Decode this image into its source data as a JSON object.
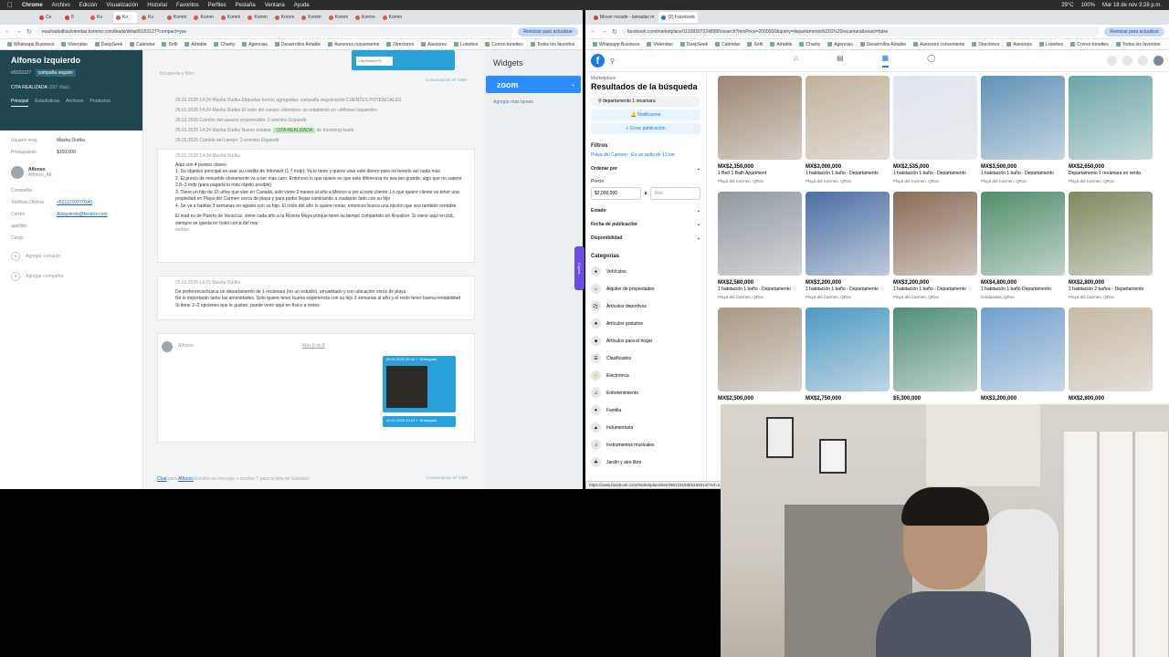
{
  "menubar": {
    "app": "Chrome",
    "items": [
      "Archivo",
      "Edición",
      "Visualización",
      "Historial",
      "Favoritos",
      "Perfiles",
      "Pestaña",
      "Ventana",
      "Ayuda"
    ],
    "clock": "Mar 18 de nov 3:28 p.m.",
    "temp": "29°C",
    "battery": "100%"
  },
  "left_browser": {
    "tabs": [
      "Ce",
      "8",
      "Ko",
      "Ko",
      "Ko",
      "Komm",
      "Komm",
      "Komm",
      "Komm",
      "Komm",
      "Komm",
      "Komm",
      "Komm",
      "Komm"
    ],
    "url": "mashadudkaviviendas.kommo.com/leads/detail/9153127?compact=yes",
    "relaunch": "Reiniciar para actualizar",
    "bookmarks": [
      "Whatsapp Business",
      "Viviendas",
      "DeepSeek",
      "Calendar",
      "Sofit",
      "Airtable",
      "Charity",
      "Agencias",
      "Desarrollos Airtable",
      "Asesores conveniente",
      "Directores",
      "Asesores",
      "Lunettes",
      "Correo tunettes",
      "Todos los favoritos"
    ]
  },
  "kommo": {
    "lead_name": "Alfonso Izquierdo",
    "lead_id": "#9153127",
    "pipeline": "campaña seguim",
    "status": "CITA REALIZADA",
    "status_days": "(297 días)",
    "tabs": [
      "Principal",
      "Estadísticas",
      "Archivos",
      "Productos"
    ],
    "fields": [
      {
        "label": "Usuario resp.",
        "value": "Masha Dudka"
      },
      {
        "label": "Presupuesto",
        "value": "$150,000"
      }
    ],
    "contact": {
      "name": "Alfonso",
      "role": "Alfonso_Alt"
    },
    "contact_fields": [
      {
        "label": "Compañía",
        "value": ""
      },
      {
        "label": "Teléfono Oficina",
        "value": "+5212292070340"
      },
      {
        "label": "Correo",
        "value": "Alizquierdo@tenaris.com"
      },
      {
        "label": "apellido",
        "value": ""
      },
      {
        "label": "Cargo",
        "value": ""
      }
    ],
    "add_contact": "Agregar contacto",
    "add_company": "Agregar compañía",
    "search_placeholder": "Búsqueda y filtro",
    "bubble_caption": "Cita Riviera Pl...",
    "conversation_label": "Conversación Nº 4459",
    "log": [
      {
        "text": "25.01.2025 14:24 Masha Dudka Etiquetas fueron agregadas: campaña seguimiento CUENTES POTENCIALES"
      },
      {
        "text": "25.01.2025 14:24 Masha Dudka El valor del campo «Nombre» se estableció en «Alfonso Izquierdo»"
      },
      {
        "text": "25.01.2025 Cambio del usuario responsable: 2 eventos Expandir"
      },
      {
        "text": "25.01.2025 14:24 Masha Dudka Nuevo estatus:",
        "badge": "CITA REALIZADA",
        "suffix": "de Incoming leads"
      },
      {
        "text": "25.01.2025 Cambio del campo: 2 eventos Expandir"
      }
    ],
    "note1": {
      "meta": "25.01.2025 14:24 Masha Dudka",
      "lines": [
        "Aqui son 4 puntos claves:",
        "1. Su objetivo principal es usar su crédito de Infonavit (1.7 mdp). Ya lo tiene y quiere usar este dinero para no tenerlo así nada más",
        "2. El precio de inmueble obviamente va a ser más caro. Entonces lo que quiere es que esta diferencia no sea tan grande, algo que no supere 2.8–3 mdp (para pagarla lo más rápido posible)",
        "3. Tiene un hijo de 15 años que vive en Canadá, solo viene 2 meses al año a México a ver al este cliente. Lo que quiere cliente es tener una propiedad en Playa del Carmen cerca de playa y para poder llegar caminando a cualquier lado con su hijo",
        "4. Se va a habitar 3 semanas en agosto con su hijo. El resto del año lo quiere rentar, entonces busca una opción que sea también rentable",
        "El lead es de Puerto de Veracruz, viene cada año a la Riviera Maya porque tiene su tiempo compartido en Royalton. Si viene aquí en pdc, siempre se queda en hotel cerca del mar"
      ],
      "edit": "eeditar"
    },
    "note2": {
      "meta": "25.01.2025 14:25 Masha Dudka",
      "lines": [
        "De preferencia busca un departamento de 1 recámara (no un estudio), amueblado y con ubicación cerca de playa",
        "No le importarán tanto las amenidades. Solo quiere tener buena experiencia con su hijo 3 semanas al año y el resto tener buena rentabilidad",
        "Si tiene 2–3 opciones que le gustan, puede venir aquí en físico a vistos"
      ]
    },
    "chat_sender": "Alfonso",
    "chat_meta": "Más 8 de 8",
    "chat_time1": "26.01.2025 20:14 ✓ Entregado",
    "chat_time2": "26.01.2025 20:14 ✓ Entregado",
    "chat_input": {
      "prefix": "Chat",
      "mid": "para",
      "to": "Alfonso",
      "placeholder": "Escribe un mensaje o escribe '/' para la lista de Salesbot"
    },
    "widgets_title": "Widgets",
    "zoom_label": "zoom",
    "add_tasks": "Agregar más tareas",
    "copilot": "Copilot"
  },
  "right_browser": {
    "tabs": [
      "Mover recade - lamadas m",
      "(2) Facebook"
    ],
    "url": "facebook.com/marketplace/111093072248995/search?minPrice=2000000&query=departamento%201%20recamara&exact=false",
    "relaunch": "Reiniciar para actualizar",
    "bookmarks": [
      "Whatsapp Business",
      "Viviendas",
      "DeepSeek",
      "Calendar",
      "Sofit",
      "Airtable",
      "Charity",
      "Agencias",
      "Desarrollos Airtable",
      "Asesores conveniente",
      "Directores",
      "Asesores",
      "Lunettes",
      "Correo tunettes",
      "Todos los favoritos"
    ],
    "status_url": "https://www.facebook.com/marketplace/item/9612419303184014/?ref=s..."
  },
  "facebook": {
    "crumb": "Marketplace",
    "heading": "Resultados de la búsqueda",
    "query": "departamento 1 recamara",
    "notify": "Notificarme",
    "create": "+ Crear publicación",
    "filters": "Filtros",
    "location": "Playa del Carmen · En un radio de 13 km",
    "sort": "Ordenar por",
    "price_label": "Precio",
    "price_min": "$2,000,000",
    "price_sep": "a",
    "price_max": "Máx",
    "state": "Estado",
    "pub_date": "Fecha de publicación",
    "availability": "Disponibilidad",
    "categories_title": "Categorías",
    "categories": [
      "Vehículos",
      "Alquiler de propiedades",
      "Artículos deportivos",
      "Artículos gratuitos",
      "Artículos para el hogar",
      "Clasificados",
      "Electrónica",
      "Entretenimiento",
      "Familia",
      "Indumentaria",
      "Instrumentos musicales",
      "Jardín y aire libre"
    ],
    "listings": [
      {
        "price": "MX$2,350,000",
        "title": "1 Bed 1 Bath Apartment",
        "loc": "Playa del Carmen, QRoo",
        "color": "#9b8670"
      },
      {
        "price": "MX$3,000,000",
        "title": "1 habitación 1 baño - Departamento",
        "loc": "Playa del Carmen, QRoo",
        "color": "#c2b29b"
      },
      {
        "price": "MX$2,535,000",
        "title": "1 habitación 1 baño - Departamento",
        "loc": "Playa del Carmen, QRoo",
        "color": "#dfe6ef"
      },
      {
        "price": "MX$3,500,000",
        "title": "1 habitación 1 baño - Departamento",
        "loc": "Playa del Carmen, QRoo",
        "color": "#5f93b8"
      },
      {
        "price": "MX$2,650,000",
        "title": "Departamento 1 recámara en venta",
        "loc": "Playa del Carmen, QRoo",
        "color": "#6aa6a8"
      },
      {
        "price": "MX$2,580,000",
        "title": "1 habitación 1 baño - Departamento",
        "loc": "Playa del Carmen, QRoo",
        "color": "#8f99a1"
      },
      {
        "price": "MX$3,200,000",
        "title": "1 habitación 1 baño - Departamento",
        "loc": "Playa del Carmen, QRoo",
        "color": "#4a6ea6"
      },
      {
        "price": "MX$3,200,000",
        "title": "1 habitación 1 baño - Departamento",
        "loc": "Playa del Carmen, QRoo",
        "color": "#8a6a55"
      },
      {
        "price": "MX$4,800,000",
        "title": "1 habitación 1 baño Departamento",
        "loc": "Solidaridad, QRoo",
        "color": "#4f8f6a"
      },
      {
        "price": "MX$2,800,000",
        "title": "1 habitación 2 baños - Departamento",
        "loc": "Playa del Carmen, QRoo",
        "color": "#7d8a5e"
      },
      {
        "price": "MX$2,500,000",
        "title": "",
        "loc": "",
        "color": "#a99884"
      },
      {
        "price": "MX$2,750,000",
        "title": "",
        "loc": "",
        "color": "#4b9ac4"
      },
      {
        "price": "$5,300,000",
        "title": "",
        "loc": "",
        "color": "#4f8f77"
      },
      {
        "price": "MX$3,200,000",
        "title": "",
        "loc": "",
        "color": "#6fa0cf"
      },
      {
        "price": "MX$2,800,000",
        "title": "",
        "loc": "",
        "color": "#c7b9a4"
      }
    ]
  }
}
